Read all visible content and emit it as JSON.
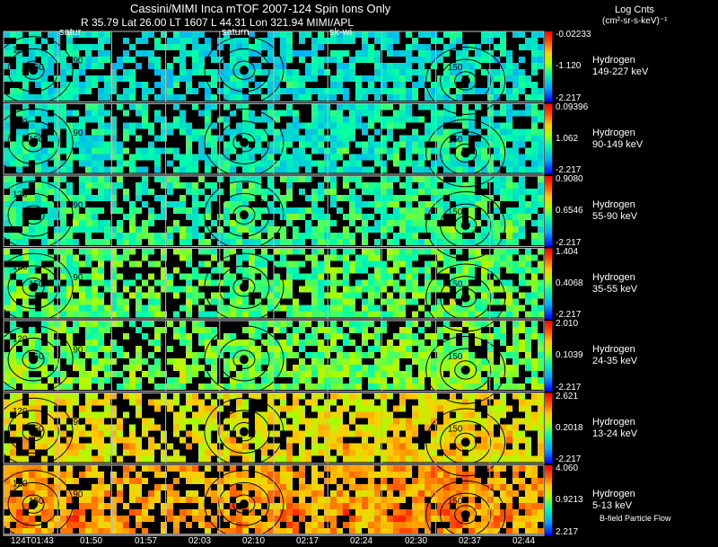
{
  "header": {
    "title": "Cassini/MIMI Inca mTOF  2007-124   Spin   Ions Only",
    "subtitle": "R       35.79 Lat 26.00 LT 1607 L       44.31 Lon       321.94  MIMI/APL",
    "units_line1": "Log Cnts",
    "units_line2": "(cm²-sr-s-keV)⁻¹"
  },
  "column_labels": [
    {
      "text": "satur",
      "col": 1
    },
    {
      "text": "saturn",
      "col": 4
    },
    {
      "text": "sk-wi",
      "col": 6
    }
  ],
  "footnote": "B-field Particle Flow",
  "chart_data": {
    "type": "heatmap",
    "title": "Cassini/MIMI Inca mTOF  2007-124   Spin   Ions Only",
    "colorbar_label": "Log Cnts (cm²-sr-s-keV)⁻¹",
    "time_ticks": [
      "124T01:43",
      "01:50",
      "01:57",
      "02:03",
      "02:10",
      "02:17",
      "02:24",
      "02:30",
      "02:37",
      "02:44"
    ],
    "columns_per_row": 10,
    "contour_labels": [
      "120",
      "150",
      "90",
      "150"
    ],
    "panels": [
      {
        "species": "Hydrogen",
        "energy": "149-227 keV",
        "cb_max": "-0.02233",
        "cb_mid": "-1.120",
        "cb_min": "-2.217",
        "level": 0.3
      },
      {
        "species": "Hydrogen",
        "energy": "90-149 keV",
        "cb_max": "0.09396",
        "cb_mid": "1.062",
        "cb_min": "-2.217",
        "level": 0.33
      },
      {
        "species": "Hydrogen",
        "energy": "55-90 keV",
        "cb_max": "0.9080",
        "cb_mid": "0.6546",
        "cb_min": "-2.217",
        "level": 0.38
      },
      {
        "species": "Hydrogen",
        "energy": "35-55 keV",
        "cb_max": "1.404",
        "cb_mid": "0.4068",
        "cb_min": "-2.217",
        "level": 0.43
      },
      {
        "species": "Hydrogen",
        "energy": "24-35 keV",
        "cb_max": "2.010",
        "cb_mid": "0.1039",
        "cb_min": "-2.217",
        "level": 0.46
      },
      {
        "species": "Hydrogen",
        "energy": "13-24 keV",
        "cb_max": "2.621",
        "cb_mid": "0.2018",
        "cb_min": "-2.217",
        "level": 0.62
      },
      {
        "species": "Hydrogen",
        "energy": "5-13 keV",
        "cb_max": "4.060",
        "cb_mid": "0.9213",
        "cb_min": "2.217",
        "level": 0.72
      }
    ]
  }
}
